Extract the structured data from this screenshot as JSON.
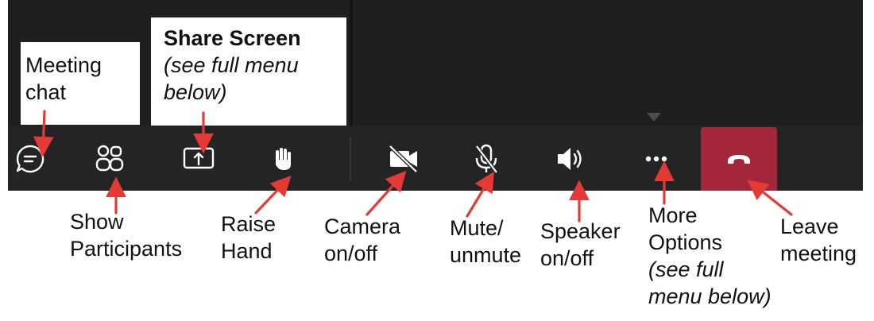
{
  "callouts": {
    "meeting_chat": "Meeting chat",
    "share_screen_title": "Share Screen",
    "share_screen_note": "(see full menu below)"
  },
  "toolbar": {
    "buttons": [
      {
        "name": "meeting-chat",
        "icon": "chat-bubble-icon"
      },
      {
        "name": "show-participants",
        "icon": "people-icon"
      },
      {
        "name": "share-screen",
        "icon": "share-screen-icon"
      },
      {
        "name": "raise-hand",
        "icon": "hand-icon"
      },
      {
        "name": "camera",
        "icon": "camera-off-icon"
      },
      {
        "name": "mute",
        "icon": "mic-off-icon"
      },
      {
        "name": "speaker",
        "icon": "speaker-icon"
      },
      {
        "name": "more-options",
        "icon": "ellipsis-icon"
      },
      {
        "name": "leave-meeting",
        "icon": "phone-hangup-icon"
      }
    ],
    "leave_color": "#a4263d",
    "background": "#242424"
  },
  "labels": {
    "show_participants": [
      "Show",
      "Participants"
    ],
    "raise_hand": [
      "Raise",
      "Hand"
    ],
    "camera": [
      "Camera",
      "on/off"
    ],
    "mute": [
      "Mute/",
      "unmute"
    ],
    "speaker": [
      "Speaker",
      "on/off"
    ],
    "more_options": [
      "More",
      "Options"
    ],
    "more_options_note": [
      "(see full",
      "menu below)"
    ],
    "leave_meeting": [
      "Leave",
      "meeting"
    ]
  },
  "colors": {
    "arrow": "#e53935",
    "icon": "#ffffff"
  }
}
